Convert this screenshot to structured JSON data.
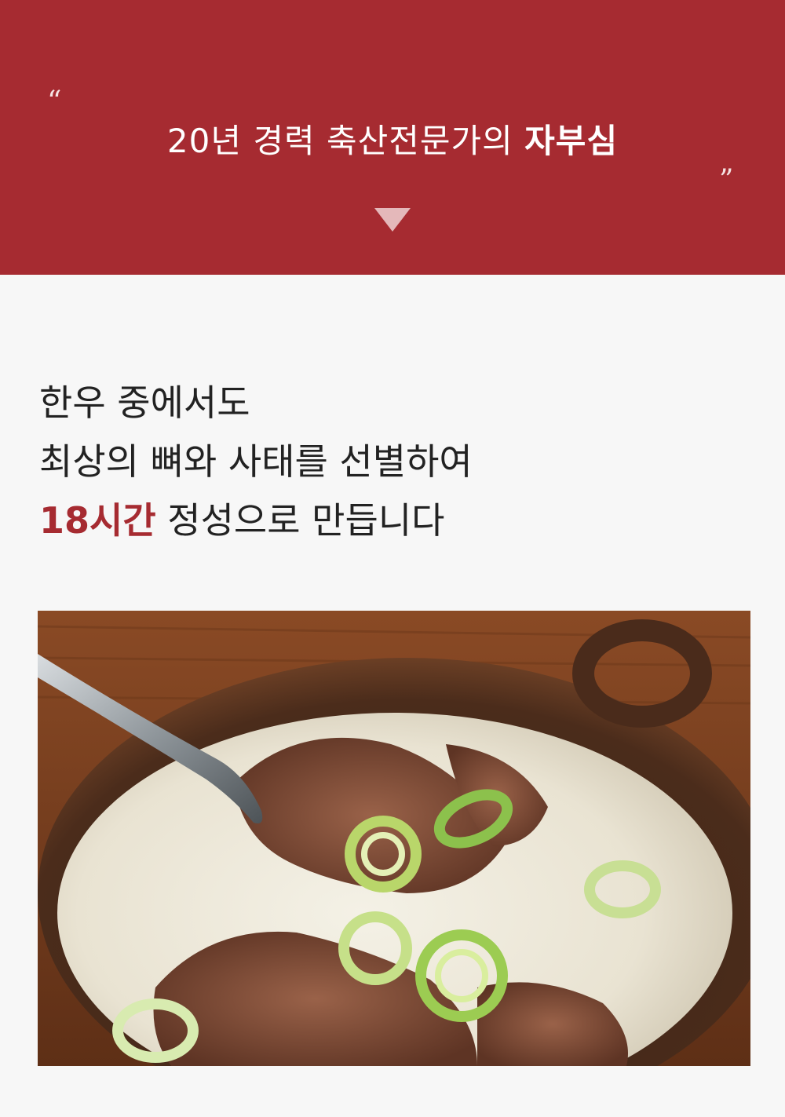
{
  "header": {
    "open_quote": "“",
    "close_quote": "”",
    "title_regular": "20년 경력 축산전문가의",
    "title_bold": "자부심"
  },
  "body": {
    "line1": "한우 중에서도",
    "line2": "최상의 뼈와 사태를 선별하여",
    "line3_accent": "18시간",
    "line3_rest": "정성으로 만듭니다"
  },
  "colors": {
    "banner": "#a62b31",
    "accent": "#a62b31",
    "background": "#f7f7f7",
    "text": "#222222"
  },
  "photo": {
    "icon": "beef-bone-soup-photo"
  }
}
